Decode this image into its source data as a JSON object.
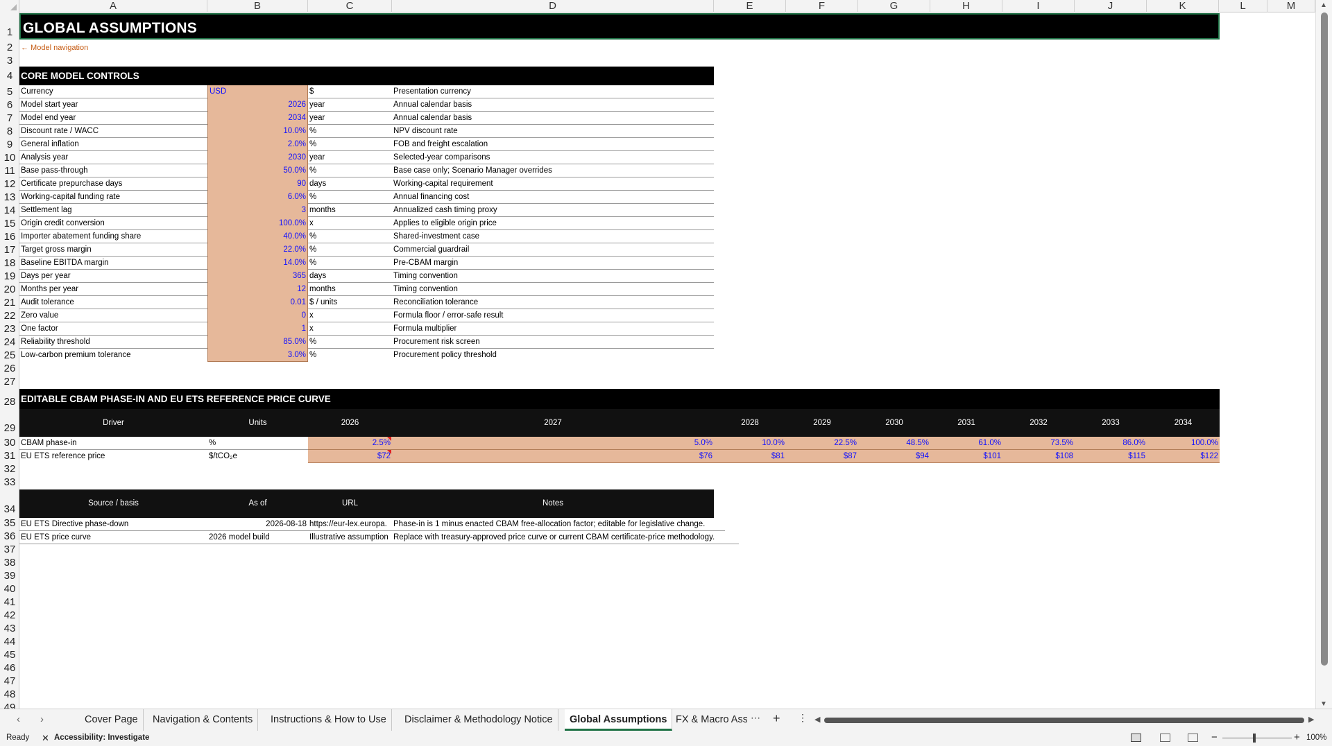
{
  "columns": [
    "A",
    "B",
    "C",
    "D",
    "E",
    "F",
    "G",
    "H",
    "I",
    "J",
    "K",
    "L",
    "M"
  ],
  "rows": [
    "1",
    "2",
    "3",
    "4",
    "5",
    "6",
    "7",
    "8",
    "9",
    "10",
    "11",
    "12",
    "13",
    "14",
    "15",
    "16",
    "17",
    "18",
    "19",
    "20",
    "21",
    "22",
    "23",
    "24",
    "25",
    "26",
    "27",
    "28",
    "29",
    "30",
    "31",
    "32",
    "33",
    "34",
    "35",
    "36",
    "37",
    "38",
    "39",
    "40",
    "41",
    "42",
    "43",
    "44",
    "45",
    "46",
    "47",
    "48",
    "49"
  ],
  "title": "GLOBAL ASSUMPTIONS",
  "nav_link": "← Model navigation",
  "core": {
    "header": "CORE MODEL CONTROLS",
    "rows": [
      {
        "label": "Currency",
        "value": "USD",
        "unit": "$",
        "note": "Presentation currency"
      },
      {
        "label": "Model start year",
        "value": "2026",
        "unit": "year",
        "note": "Annual calendar basis"
      },
      {
        "label": "Model end year",
        "value": "2034",
        "unit": "year",
        "note": "Annual calendar basis"
      },
      {
        "label": "Discount rate / WACC",
        "value": "10.0%",
        "unit": "%",
        "note": "NPV discount rate"
      },
      {
        "label": "General inflation",
        "value": "2.0%",
        "unit": "%",
        "note": "FOB and freight escalation"
      },
      {
        "label": "Analysis year",
        "value": "2030",
        "unit": "year",
        "note": "Selected-year comparisons"
      },
      {
        "label": "Base pass-through",
        "value": "50.0%",
        "unit": "%",
        "note": "Base case only; Scenario Manager overrides"
      },
      {
        "label": "Certificate prepurchase days",
        "value": "90",
        "unit": "days",
        "note": "Working-capital requirement"
      },
      {
        "label": "Working-capital funding rate",
        "value": "6.0%",
        "unit": "%",
        "note": "Annual financing cost"
      },
      {
        "label": "Settlement lag",
        "value": "3",
        "unit": "months",
        "note": "Annualized cash timing proxy"
      },
      {
        "label": "Origin credit conversion",
        "value": "100.0%",
        "unit": "x",
        "note": "Applies to eligible origin price"
      },
      {
        "label": "Importer abatement funding share",
        "value": "40.0%",
        "unit": "%",
        "note": "Shared-investment case"
      },
      {
        "label": "Target gross margin",
        "value": "22.0%",
        "unit": "%",
        "note": "Commercial guardrail"
      },
      {
        "label": "Baseline EBITDA margin",
        "value": "14.0%",
        "unit": "%",
        "note": "Pre-CBAM margin"
      },
      {
        "label": "Days per year",
        "value": "365",
        "unit": "days",
        "note": "Timing convention"
      },
      {
        "label": "Months per year",
        "value": "12",
        "unit": "months",
        "note": "Timing convention"
      },
      {
        "label": "Audit tolerance",
        "value": "0.01",
        "unit": "$ / units",
        "note": "Reconciliation tolerance"
      },
      {
        "label": "Zero value",
        "value": "0",
        "unit": "x",
        "note": "Formula floor / error-safe result"
      },
      {
        "label": "One factor",
        "value": "1",
        "unit": "x",
        "note": "Formula multiplier"
      },
      {
        "label": "Reliability threshold",
        "value": "85.0%",
        "unit": "%",
        "note": "Procurement risk screen"
      },
      {
        "label": "Low-carbon premium tolerance",
        "value": "3.0%",
        "unit": "%",
        "note": "Procurement policy threshold"
      }
    ]
  },
  "curve": {
    "header": "EDITABLE CBAM PHASE-IN AND EU ETS REFERENCE PRICE CURVE",
    "col_driver": "Driver",
    "col_units": "Units",
    "years": [
      "2026",
      "2027",
      "2028",
      "2029",
      "2030",
      "2031",
      "2032",
      "2033",
      "2034"
    ],
    "rows": [
      {
        "driver": "CBAM phase-in",
        "units": "%",
        "values": [
          "2.5%",
          "5.0%",
          "10.0%",
          "22.5%",
          "48.5%",
          "61.0%",
          "73.5%",
          "86.0%",
          "100.0%"
        ]
      },
      {
        "driver": "EU ETS reference price",
        "units": "$/tCO₂e",
        "values": [
          "$72",
          "$76",
          "$81",
          "$87",
          "$94",
          "$101",
          "$108",
          "$115",
          "$122"
        ]
      }
    ]
  },
  "sources": {
    "headers": [
      "Source / basis",
      "As of",
      "URL",
      "Notes"
    ],
    "rows": [
      {
        "source": "EU ETS Directive phase-down",
        "asof": "2026-08-18",
        "url": "https://eur-lex.europa.",
        "notes": "Phase-in is 1 minus enacted CBAM free-allocation factor; editable for legislative change."
      },
      {
        "source": "EU ETS price curve",
        "asof": "2026 model build",
        "url": "Illustrative assumption",
        "notes": "Replace with treasury-approved price curve or current CBAM certificate-price methodology."
      }
    ]
  },
  "tabs": [
    "Cover Page",
    "Navigation & Contents",
    "Instructions & How to Use",
    "Disclaimer & Methodology Notice",
    "Global Assumptions",
    "FX & Macro Assu"
  ],
  "active_tab": "Global Assumptions",
  "status": {
    "ready": "Ready",
    "accessibility": "Accessibility: Investigate",
    "zoom": "100%"
  },
  "colors": {
    "input_fill": "#e6b89a",
    "input_text": "#1010ff",
    "header_bg": "#000000",
    "accent": "#1e7145"
  }
}
